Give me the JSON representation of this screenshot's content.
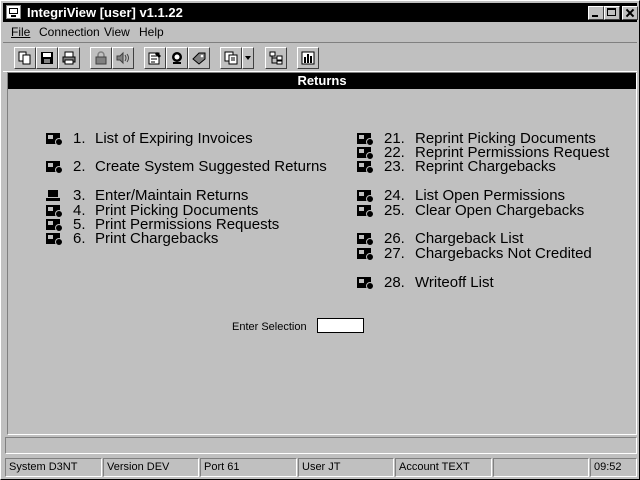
{
  "window": {
    "title": "IntegriView [user]  v1.1.22"
  },
  "menu": {
    "file": "File",
    "connection": "Connection",
    "view": "View",
    "help": "Help"
  },
  "toolbar_icons": [
    "copy-icon",
    "save-icon",
    "print-icon",
    "lock-icon",
    "audio-icon",
    "properties-icon",
    "monitor-icon",
    "tag-icon",
    "window-icon",
    "dropdown-arrow-icon",
    "tree-icon",
    "chart-icon"
  ],
  "screen": {
    "title": "Returns"
  },
  "left_menu": [
    {
      "num": "1.",
      "label": "List of Expiring Invoices"
    },
    {
      "num": "2.",
      "label": "Create System Suggested Returns"
    },
    {
      "num": "3.",
      "label": "Enter/Maintain Returns"
    },
    {
      "num": "4.",
      "label": "Print Picking Documents"
    },
    {
      "num": "5.",
      "label": "Print Permissions Requests"
    },
    {
      "num": "6.",
      "label": "Print Chargebacks"
    }
  ],
  "right_menu": [
    {
      "num": "21.",
      "label": "Reprint Picking Documents"
    },
    {
      "num": "22.",
      "label": "Reprint Permissions Request"
    },
    {
      "num": "23.",
      "label": "Reprint Chargebacks"
    },
    {
      "num": "24.",
      "label": "List Open Permissions"
    },
    {
      "num": "25.",
      "label": "Clear Open Chargebacks"
    },
    {
      "num": "26.",
      "label": "Chargeback List"
    },
    {
      "num": "27.",
      "label": "Chargebacks Not Credited"
    },
    {
      "num": "28.",
      "label": "Writeoff List"
    }
  ],
  "selection": {
    "label": "Enter Selection",
    "value": ""
  },
  "status": {
    "system": "System D3NT",
    "version": "Version DEV",
    "port": "Port 61",
    "user": "User JT",
    "account": "Account TEXT",
    "blank": "",
    "time": "09:52"
  }
}
